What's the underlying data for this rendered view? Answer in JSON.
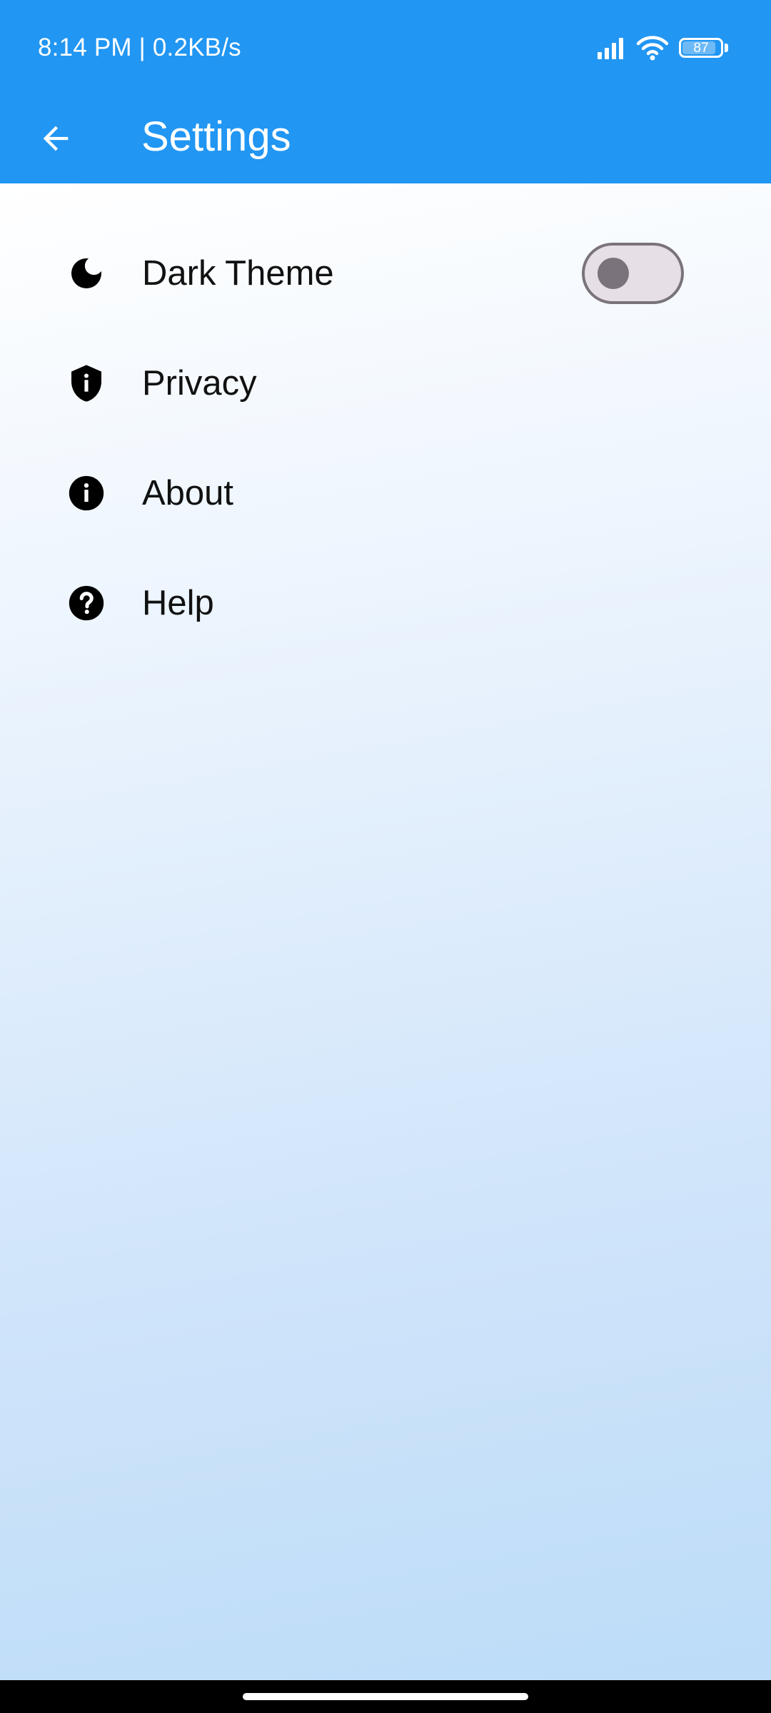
{
  "status_bar": {
    "time_speed": "8:14 PM | 0.2KB/s",
    "battery": "87",
    "icons": [
      "signal-icon",
      "wifi-icon",
      "battery-icon"
    ]
  },
  "app_bar": {
    "title": "Settings",
    "back_icon": "arrow-back-icon",
    "color": "#2196F3"
  },
  "settings": {
    "items": [
      {
        "label": "Dark Theme",
        "icon": "moon-icon",
        "toggle": true,
        "toggle_on": false
      },
      {
        "label": "Privacy",
        "icon": "shield-info-icon"
      },
      {
        "label": "About",
        "icon": "info-icon"
      },
      {
        "label": "Help",
        "icon": "help-icon"
      }
    ]
  }
}
